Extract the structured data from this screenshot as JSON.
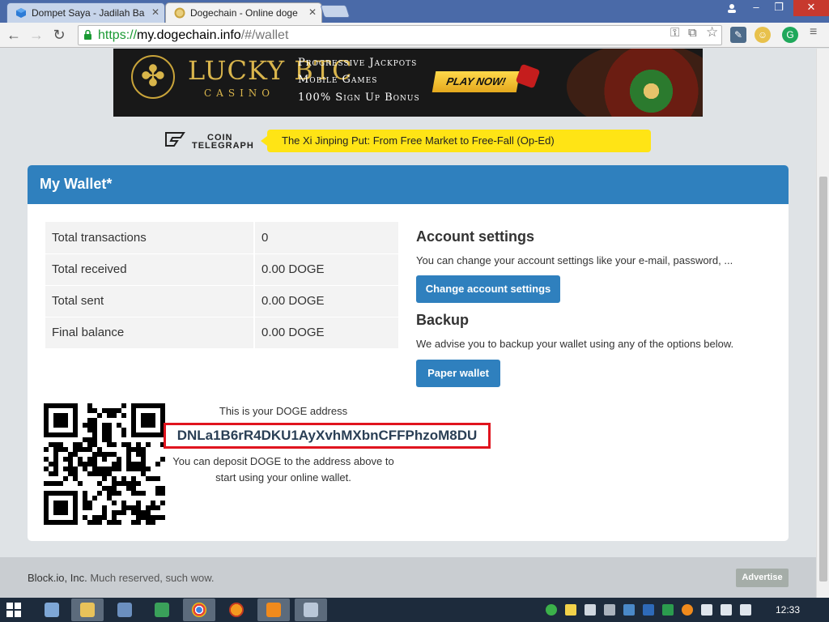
{
  "browser": {
    "tabs": [
      {
        "title": "Dompet Saya - Jadilah Ba",
        "active": false
      },
      {
        "title": "Dogechain - Online doge",
        "active": true
      }
    ],
    "url": {
      "scheme": "https://",
      "host": "my.dogechain.info",
      "path": "/#/wallet"
    }
  },
  "banner": {
    "brand": "LUCKY BTC",
    "subbrand": "CASINO",
    "lines": [
      "Progressive Jackpots",
      "Mobile Games",
      "100% Sign Up Bonus"
    ],
    "cta": "PLAY NOW!"
  },
  "news": {
    "source_line1": "COIN",
    "source_line2": "TELEGRAPH",
    "headline": "The Xi Jinping Put: From Free Market to Free-Fall (Op-Ed)"
  },
  "wallet": {
    "title": "My Wallet*",
    "stats": [
      {
        "label": "Total transactions",
        "value": "0"
      },
      {
        "label": "Total received",
        "value": "0.00 DOGE"
      },
      {
        "label": "Total sent",
        "value": "0.00 DOGE"
      },
      {
        "label": "Final balance",
        "value": "0.00 DOGE"
      }
    ],
    "account_settings": {
      "title": "Account settings",
      "text": "You can change your account settings like your e-mail, password, ...",
      "button": "Change account settings"
    },
    "backup": {
      "title": "Backup",
      "text": "We advise you to backup your wallet using any of the options below.",
      "button": "Paper wallet"
    },
    "address": {
      "caption": "This is your DOGE address",
      "value": "DNLa1B6rR4DKU1AyXvhMXbnCFFPhzoM8DU",
      "deposit_line1": "You can deposit DOGE to the address above to",
      "deposit_line2": "start using your online wallet."
    }
  },
  "footer": {
    "company": "Block.io, Inc.",
    "tagline": " Much reserved, such wow.",
    "advertise": "Advertise"
  },
  "taskbar": {
    "time": "12:33"
  },
  "colors": {
    "primary": "#2f80be",
    "headline_bg": "#ffe415",
    "address_border": "#e0141e",
    "https_green": "#1a9a33"
  }
}
